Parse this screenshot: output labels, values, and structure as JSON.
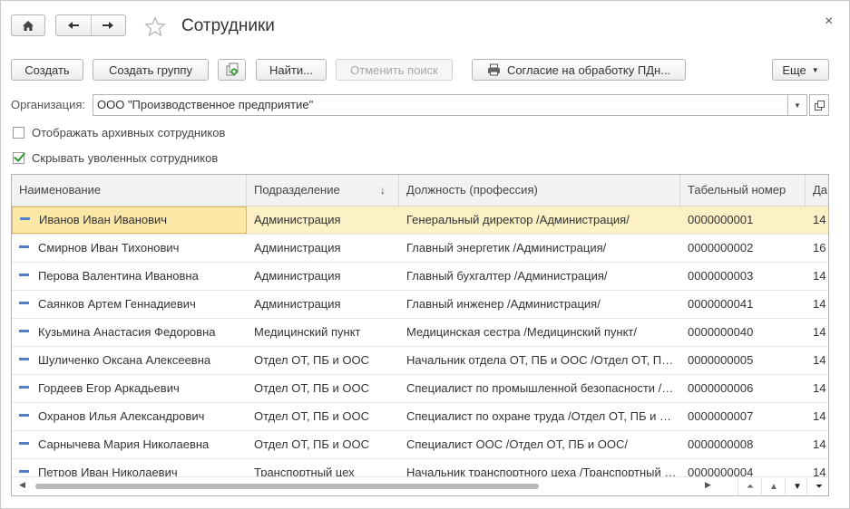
{
  "window": {
    "title": "Сотрудники",
    "close_glyph": "×"
  },
  "nav": {
    "home_icon": "home-icon",
    "back_icon": "arrow-left-icon",
    "forward_icon": "arrow-right-icon",
    "favorite_icon": "star-icon"
  },
  "toolbar": {
    "create": "Создать",
    "create_group": "Создать группу",
    "copy_icon": "copy-icon",
    "find": "Найти...",
    "cancel_search": "Отменить поиск",
    "consent": "Согласие на обработку ПДн...",
    "more": "Еще"
  },
  "org": {
    "label": "Организация:",
    "value": "ООО \"Производственное предприятие\""
  },
  "filters": {
    "show_archive": {
      "label": "Отображать архивных сотрудников",
      "checked": false
    },
    "hide_fired": {
      "label": "Скрывать уволенных сотрудников",
      "checked": true
    }
  },
  "table": {
    "columns": [
      "Наименование",
      "Подразделение",
      "Должность (профессия)",
      "Табельный номер",
      "Да"
    ],
    "sort_indicator": "↓",
    "rows": [
      [
        "Иванов Иван Иванович",
        "Администрация",
        "Генеральный директор /Администрация/",
        "0000000001",
        "14"
      ],
      [
        "Смирнов Иван Тихонович",
        "Администрация",
        "Главный энергетик /Администрация/",
        "0000000002",
        "16"
      ],
      [
        "Перова Валентина Ивановна",
        "Администрация",
        "Главный бухгалтер /Администрация/",
        "0000000003",
        "14"
      ],
      [
        "Саянков Артем Геннадиевич",
        "Администрация",
        "Главный инженер /Администрация/",
        "0000000041",
        "14"
      ],
      [
        "Кузьмина Анастасия Федоровна",
        "Медицинский пункт",
        "Медицинская сестра /Медицинский пункт/",
        "0000000040",
        "14"
      ],
      [
        "Шуличенко Оксана Алексеевна",
        "Отдел ОТ, ПБ и ООС",
        "Начальник отдела ОТ, ПБ и ООС /Отдел ОТ, ПБ и ООС/",
        "0000000005",
        "14"
      ],
      [
        "Гордеев Егор Аркадьевич",
        "Отдел ОТ, ПБ и ООС",
        "Специалист по промышленной безопасности /Отдел ОТ, ПБ и ООС/",
        "0000000006",
        "14"
      ],
      [
        "Охранов Илья Александрович",
        "Отдел ОТ, ПБ и ООС",
        "Специалист по охране труда /Отдел ОТ, ПБ и ООС/",
        "0000000007",
        "14"
      ],
      [
        "Сарнычева Мария Николаевна",
        "Отдел ОТ, ПБ и ООС",
        "Специалист ООС /Отдел ОТ, ПБ и ООС/",
        "0000000008",
        "14"
      ],
      [
        "Петров Иван Николаевич",
        "Транспортный цех",
        "Начальник транспортного цеха /Транспортный цех/",
        "0000000004",
        "14"
      ]
    ],
    "selected_row": 0
  },
  "colors": {
    "selected_row": "#fbf0c6",
    "selected_cell_border": "#e3b84f",
    "row_icon": "#4f7fc4",
    "check": "#2f9a2f"
  }
}
